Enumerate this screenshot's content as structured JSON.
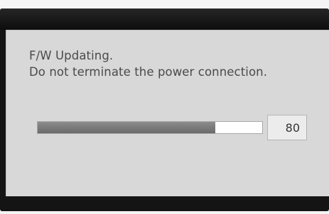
{
  "dialog": {
    "line1": "F/W Updating.",
    "line2": "Do not terminate the power connection."
  },
  "progress": {
    "value_label": "80",
    "fraction": 0.79
  },
  "colors": {
    "titlebar": "#141414",
    "panel": "#d8d8d8",
    "bar_fill": "#7a7a7a",
    "bar_track": "#ffffff"
  }
}
